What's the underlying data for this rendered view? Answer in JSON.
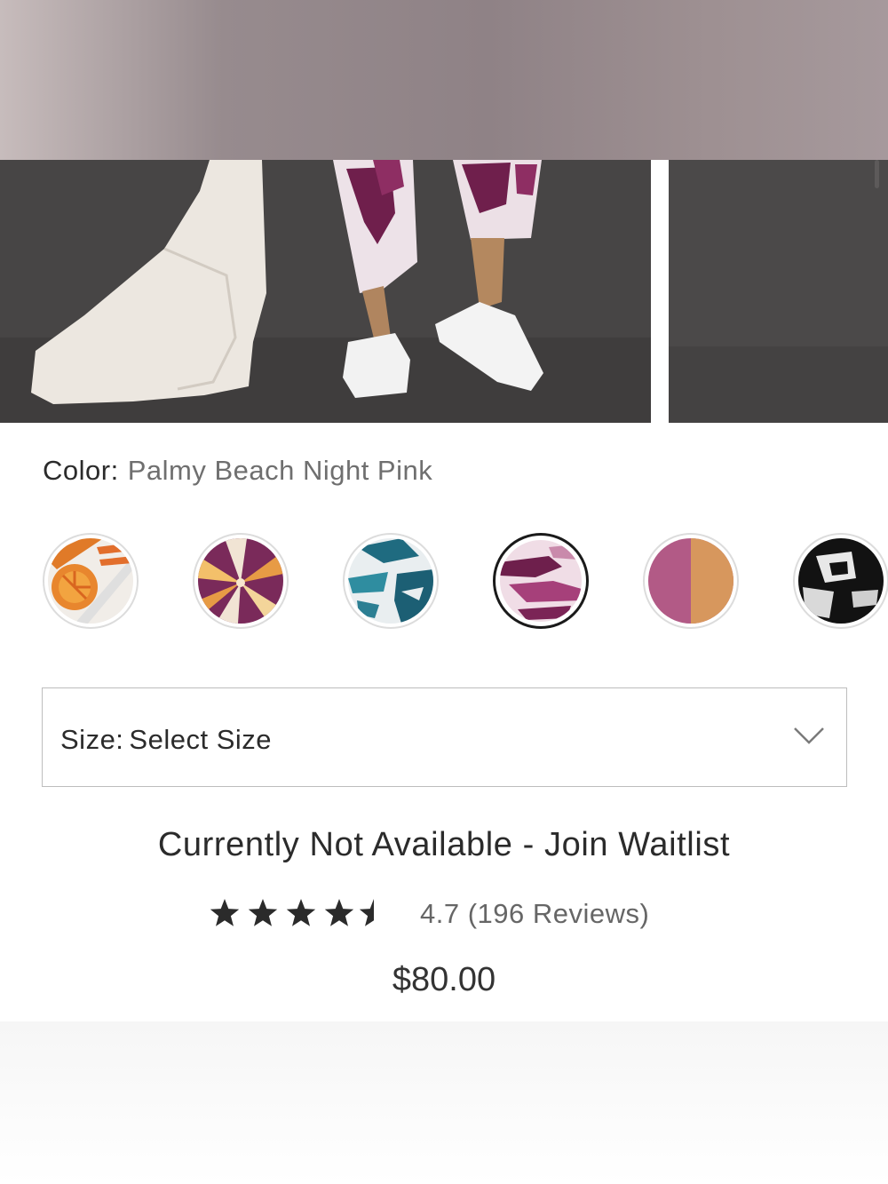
{
  "product": {
    "color_label": "Color:",
    "color_value": "Palmy Beach Night Pink",
    "swatches": [
      {
        "name": "orange-citrus-stripe",
        "selected": false
      },
      {
        "name": "purple-starburst",
        "selected": false
      },
      {
        "name": "teal-tie-dye",
        "selected": false
      },
      {
        "name": "palmy-beach-night-pink",
        "selected": true
      },
      {
        "name": "pink-tan-colorblock",
        "selected": false
      },
      {
        "name": "black-white-print",
        "selected": false
      }
    ],
    "size_label": "Size:",
    "size_value": "Select Size",
    "availability": "Currently Not Available - Join Waitlist",
    "rating": 4.7,
    "rating_text": "4.7 (196 Reviews)",
    "price": "$80.00"
  },
  "icons": {
    "size_dropdown": "chevron-down-icon",
    "rating": "star-icon"
  }
}
